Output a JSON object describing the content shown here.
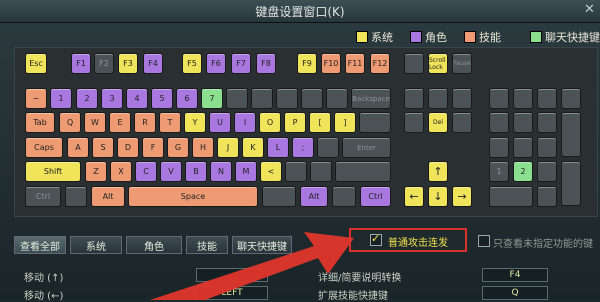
{
  "window": {
    "title": "键盘设置窗口(K)"
  },
  "legend": [
    {
      "label": "系统",
      "color": "#f0e45a"
    },
    {
      "label": "角色",
      "color": "#a977e0"
    },
    {
      "label": "技能",
      "color": "#ee9b73"
    },
    {
      "label": "聊天快捷键",
      "color": "#8be08f"
    }
  ],
  "keys": {
    "esc": "Esc",
    "f1": "F1",
    "f2": "F2",
    "f3": "F3",
    "f4": "F4",
    "f5": "F5",
    "f6": "F6",
    "f7": "F7",
    "f8": "F8",
    "f9": "F9",
    "f10": "F10",
    "f11": "F11",
    "f12": "F12",
    "scroll": "Scroll Lock",
    "pause": "Pause",
    "tilde": "~",
    "n1": "1",
    "n2": "2",
    "n3": "3",
    "n4": "4",
    "n5": "5",
    "n6": "6",
    "n7": "7",
    "backspace": "Backspace",
    "tab": "Tab",
    "q": "Q",
    "w": "W",
    "e": "E",
    "r": "R",
    "t": "T",
    "y": "Y",
    "u": "U",
    "i": "I",
    "o": "O",
    "p": "P",
    "lbr": "[",
    "rbr": "]",
    "del": "Del",
    "caps": "Caps",
    "a": "A",
    "s": "S",
    "d": "D",
    "f": "F",
    "g": "G",
    "h": "H",
    "j": "J",
    "k": "K",
    "l": "L",
    "semi": ";",
    "enter": "Enter",
    "shift": "Shift",
    "z": "Z",
    "x": "X",
    "c": "C",
    "v": "V",
    "b": "B",
    "n": "N",
    "m": "M",
    "lt": "<",
    "ctrl": "Ctrl",
    "alt": "Alt",
    "space": "Space",
    "ralt": "Alt",
    "rctrl": "Ctrl",
    "up": "↑",
    "left": "←",
    "down": "↓",
    "right": "→",
    "np1": "1",
    "np2": "2"
  },
  "tabs": [
    "查看全部",
    "系统",
    "角色",
    "技能",
    "聊天快捷键"
  ],
  "options": {
    "normal_attack_repeat": "普通攻击连发",
    "show_unassigned": "只查看未指定功能的键"
  },
  "bindings": [
    {
      "label": "移动 (↑)",
      "value": ""
    },
    {
      "label": "移动 (←)",
      "value": "LEFT"
    }
  ],
  "right_rows": [
    {
      "label": "详细/简要说明转换",
      "value": "F4"
    },
    {
      "label": "扩展技能快捷键",
      "value": "Q"
    }
  ]
}
